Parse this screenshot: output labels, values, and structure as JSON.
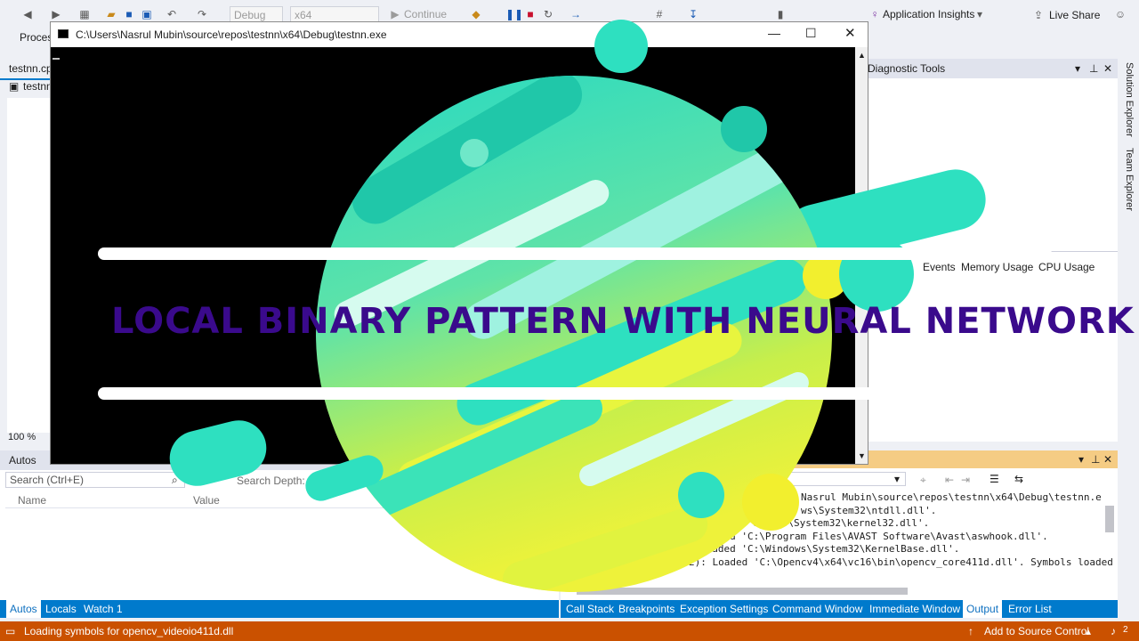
{
  "toolbar": {
    "config_combo": "Debug",
    "platform_combo": "x64",
    "continue_label": "Continue",
    "process_label": "Proces",
    "app_insights_label": "Application Insights",
    "live_share_label": "Live Share"
  },
  "left_doc": {
    "tab_label": "testnn.cp",
    "item_label": "testnn",
    "zoom": "100 %"
  },
  "diagnostic": {
    "title": "Diagnostic Tools",
    "tabs": [
      "Events",
      "Memory Usage",
      "CPU Usage"
    ]
  },
  "right_rail": {
    "solution_explorer": "Solution Explorer",
    "team_explorer": "Team Explorer"
  },
  "console": {
    "title": "C:\\Users\\Nasrul Mubin\\source\\repos\\testnn\\x64\\Debug\\testnn.exe"
  },
  "autos": {
    "title": "Autos",
    "search_placeholder": "Search (Ctrl+E)",
    "search_depth_label": "Search Depth:",
    "col_name": "Name",
    "col_value": "Value",
    "tabs": [
      "Autos",
      "Locals",
      "Watch 1"
    ]
  },
  "output": {
    "lines": [
      "Nasrul Mubin\\source\\repos\\testnn\\x64\\Debug\\testnn.e",
      "ws\\System32\\ntdll.dll'.",
      "'C:    ows\\System32\\kernel32.dll'.",
      "Loaded 'C:\\Program Files\\AVAST Software\\Avast\\aswhook.dll'.",
      "Loaded 'C:\\Windows\\System32\\KernelBase.dll'.",
      "2): Loaded 'C:\\Opencv4\\x64\\vc16\\bin\\opencv_core411d.dll'. Symbols loaded"
    ],
    "tabs": [
      "Call Stack",
      "Breakpoints",
      "Exception Settings",
      "Command Window",
      "Immediate Window",
      "Output",
      "Error List"
    ]
  },
  "status": {
    "message": "Loading symbols for opencv_videoio411d.dll",
    "source_control": "Add to Source Control",
    "notification_count": "2"
  },
  "overlay": {
    "headline": "LOCAL BINARY PATTERN WITH NEURAL NETWORK"
  },
  "colors": {
    "status_bar": "#ca5100",
    "output_header": "#f5cc84",
    "headline": "#3a0a8c",
    "teal": "#2ee0c0",
    "yellow": "#f0f03a"
  }
}
